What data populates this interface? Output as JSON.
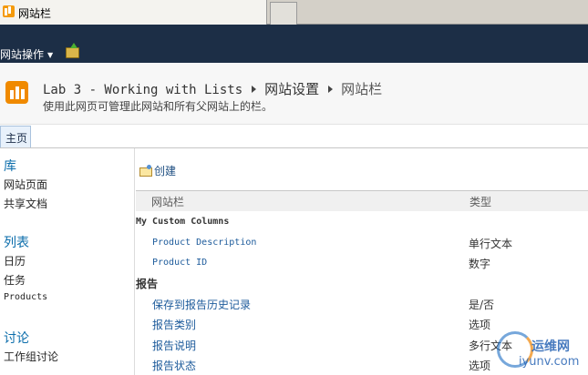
{
  "browser": {
    "tab_title": "网站栏"
  },
  "ribbon": {
    "site_actions_label": "网站操作"
  },
  "titlearea": {
    "site_name": "Lab 3 - Working with Lists",
    "parent_page": "网站设置",
    "current_page": "网站栏",
    "description": "使用此网页可管理此网站和所有父网站上的栏。"
  },
  "topnav": {
    "home_label": "主页"
  },
  "quicklaunch": {
    "libraries_heading": "库",
    "lib_site_pages": "网站页面",
    "lib_shared_docs": "共享文档",
    "lists_heading": "列表",
    "list_calendar": "日历",
    "list_tasks": "任务",
    "list_products": "Products",
    "discussions_heading": "讨论",
    "discussion_team": "工作组讨论"
  },
  "toolbar": {
    "create_label": "创建"
  },
  "table": {
    "col_name": "网站栏",
    "col_type": "类型",
    "groups": [
      {
        "title": "My Custom Columns",
        "rows": [
          {
            "name": "Product Description",
            "type": "单行文本"
          },
          {
            "name": "Product ID",
            "type": "数字"
          }
        ]
      },
      {
        "title": "报告",
        "rows": [
          {
            "name": "保存到报告历史记录",
            "type": "是/否"
          },
          {
            "name": "报告类别",
            "type": "选项"
          },
          {
            "name": "报告说明",
            "type": "多行文本"
          },
          {
            "name": "报告状态",
            "type": "选项"
          }
        ]
      }
    ]
  },
  "watermark": {
    "text_cn": "运维网",
    "text_url": "iyunv.com"
  }
}
